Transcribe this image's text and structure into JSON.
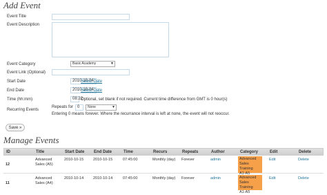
{
  "add_event": {
    "heading": "Add Event",
    "labels": {
      "title": "Event Title",
      "description": "Event Description",
      "category": "Event Category",
      "link": "Event Link (Optional)",
      "start_date": "Start Date",
      "end_date": "End Date",
      "time": "Time (hh:mm)",
      "recurring": "Recurring Events"
    },
    "values": {
      "title": "",
      "description": "",
      "category": "Basic Academy",
      "link": "",
      "start_date": "2010-10-04",
      "end_date": "2010-10-04",
      "time": "08:22",
      "repeats_count": "0",
      "repeats_interval": "None"
    },
    "select_date_label": "Select Date",
    "time_note": "Optional, set blank if not required. Current time difference from GMT is 0 hour(s)",
    "repeats_label": "Repeats for",
    "repeats_note": "Entering 0 means forever. Where the recurrance interval is left at none, the event will not reoccur.",
    "save_label": "Save »"
  },
  "manage": {
    "heading": "Manage Events",
    "columns": [
      "ID",
      "Title",
      "Start Date",
      "End Date",
      "Time",
      "Recurs",
      "Repeats",
      "Author",
      "Category",
      "Edit",
      "Delete"
    ],
    "rows": [
      {
        "id": "12",
        "title_1": "Advanced",
        "title_2": "Sales (A5)",
        "start": "2010-10-15",
        "end": "2010-10-15",
        "time": "07:45:00",
        "recurs": "Monthly (day)",
        "repeats": "Forever",
        "author": "admin",
        "category_1": "Advanced",
        "category_2": "Sales Training",
        "category_3": "A1-A5",
        "edit": "Edit",
        "delete": "Delete"
      },
      {
        "id": "11",
        "title_1": "Advanced",
        "title_2": "Sales (A4)",
        "start": "2010-10-14",
        "end": "2010-10-14",
        "time": "07:45:00",
        "recurs": "Monthly (day)",
        "repeats": "Forever",
        "author": "admin",
        "category_1": "Advanced",
        "category_2": "Sales Training",
        "category_3": "A1-A5",
        "edit": "Edit",
        "delete": "Delete"
      }
    ]
  },
  "colors": {
    "link": "#21759b",
    "category_bg": "#f7a04a",
    "input_border": "#c6d9e9"
  }
}
